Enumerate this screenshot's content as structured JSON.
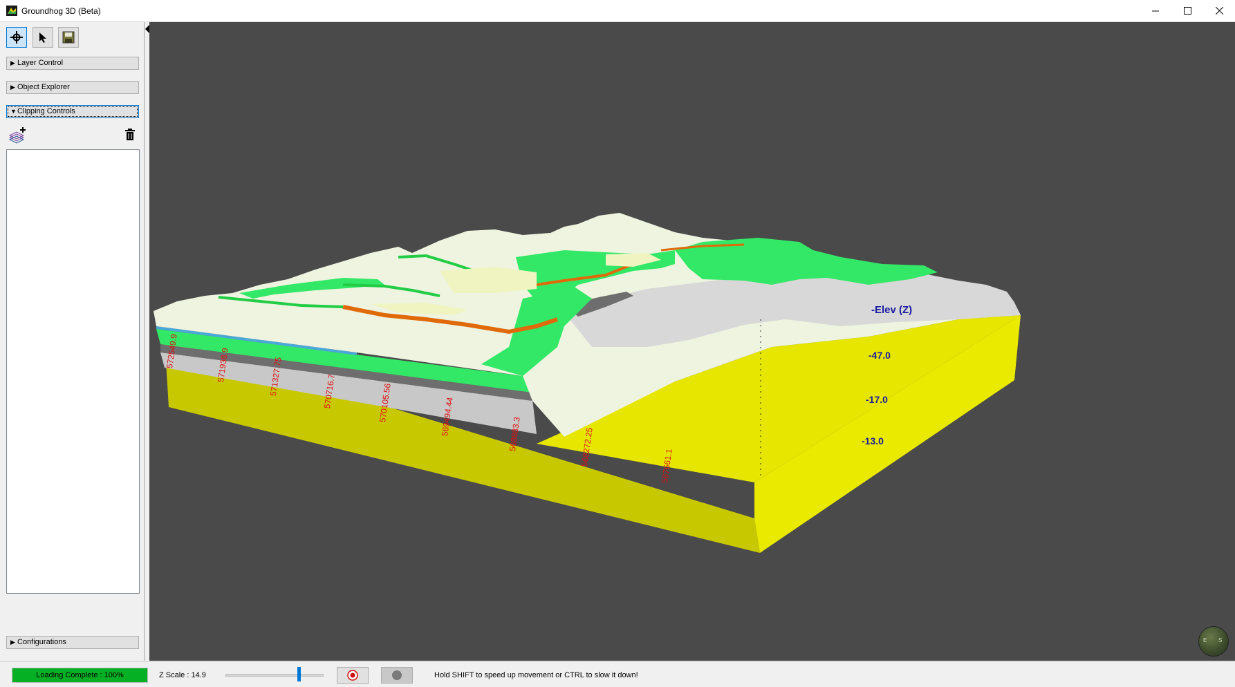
{
  "window": {
    "title": "Groundhog 3D (Beta)",
    "controls": [
      "minimize-icon",
      "maximize-icon",
      "close-icon"
    ]
  },
  "toolbar": {
    "tools": [
      {
        "icon": "move-crosshair-icon",
        "active": true
      },
      {
        "icon": "select-pointer-icon",
        "active": false
      },
      {
        "icon": "save-disk-icon",
        "active": false
      }
    ]
  },
  "panel": {
    "sections": {
      "layer_control": "Layer Control",
      "object_explorer": "Object Explorer",
      "clipping_controls": "Clipping Controls",
      "configurations": "Configurations"
    },
    "collapsed_marker": "▶",
    "expanded_marker": "▼",
    "clipping_items": []
  },
  "scene": {
    "axis_title": "-Elev (Z)",
    "elev_labels": [
      "-47.0",
      "-17.0",
      "-13.0"
    ],
    "northing_labels": [
      "572549.9",
      "571938.9",
      "571327.75",
      "570716.7",
      "570105.56",
      "569494.44",
      "568883.3",
      "568272.25",
      "567661.1"
    ],
    "label_color": "#1a1aa0",
    "tick_color": "#e01010",
    "compass_letters": [
      "E",
      "S"
    ]
  },
  "status": {
    "loading": "Loading Complete : 100%",
    "zscale": "Z Scale : 14.9",
    "zscale_slider": 0.74,
    "hint": "Hold SHIFT to speed up movement or CTRL to slow it down!"
  },
  "colors": {
    "viewport_bg": "#4a4a4a",
    "progress_green": "#06b025",
    "soil_yellow": "#c8c800",
    "soil_bright": "#eaea00",
    "layer_green": "#33e866",
    "layer_orange": "#e06a0a",
    "terrain_light": "#f4f8e8"
  }
}
